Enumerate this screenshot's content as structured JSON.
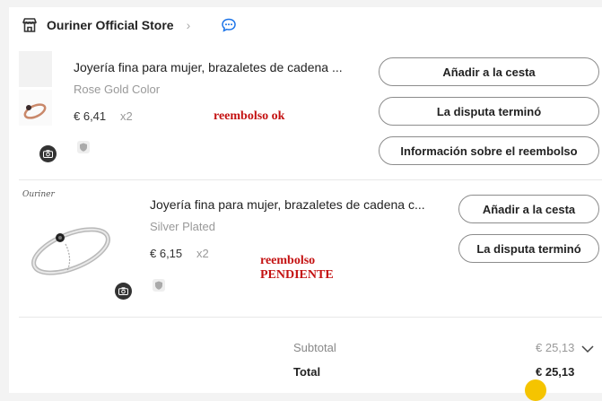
{
  "store": {
    "name": "Ouriner Official Store",
    "icon": "store-icon",
    "chat_icon": "chat-bubble-icon"
  },
  "items": [
    {
      "title": "Joyería fina para mujer, brazaletes de cadena ...",
      "variant": "Rose Gold Color",
      "price": "€ 6,41",
      "qty": "x2",
      "note": "reembolso ok",
      "buttons": [
        "Añadir a la cesta",
        "La disputa terminó",
        "Información sobre el reembolso"
      ]
    },
    {
      "title": "Joyería fina para mujer, brazaletes de cadena c...",
      "variant": "Silver Plated",
      "price": "€ 6,15",
      "qty": "x2",
      "note_line1": "reembolso",
      "note_line2": "PENDIENTE",
      "brand_mark": "Ouriner",
      "buttons": [
        "Añadir a la cesta",
        "La disputa terminó"
      ]
    }
  ],
  "summary": {
    "subtotal_label": "Subtotal",
    "subtotal_value": "€ 25,13",
    "total_label": "Total",
    "total_value": "€ 25,13"
  },
  "colors": {
    "note_red": "#c41212",
    "chat_blue": "#1a73e8",
    "coin_yellow": "#f5c400"
  }
}
